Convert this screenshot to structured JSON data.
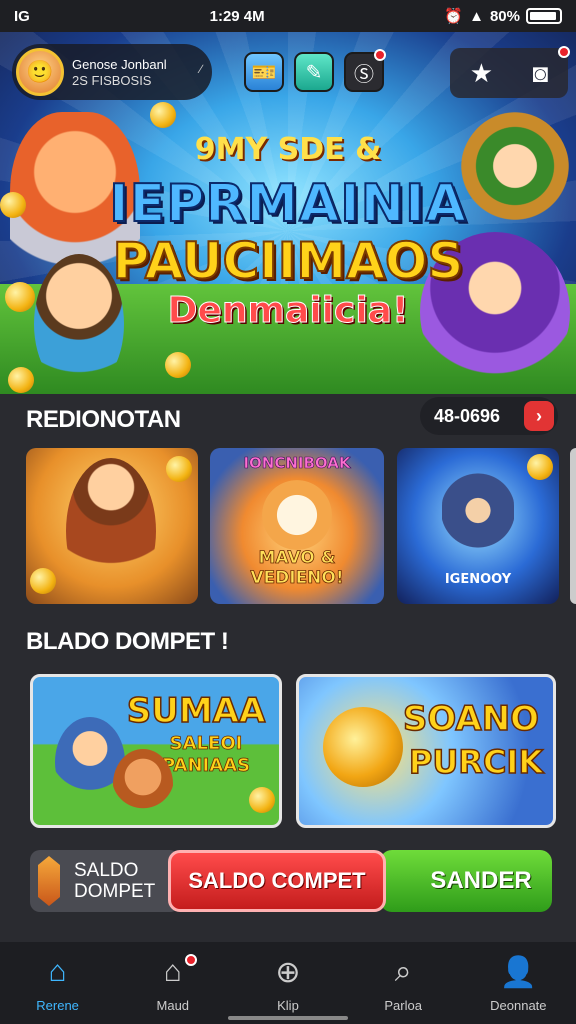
{
  "status_bar": {
    "carrier": "IG",
    "time": "1:29 4M",
    "battery": "80%"
  },
  "profile": {
    "name": "Genose Jonbanl",
    "id": "2S FISBOSIS"
  },
  "hero": {
    "line1": "9MY SDE &",
    "line2": "IEPRMAINIA",
    "line3": "PAUCIIMAOS",
    "line4": "Denmaiicia!"
  },
  "section1": {
    "title": "REDIONOTAN",
    "counter": "48-0696"
  },
  "cards_row1": [
    {
      "label": ""
    },
    {
      "label": "IONCNIBOAK",
      "sub": "MAVO & VEDIENO!"
    },
    {
      "label": "IGENOOY"
    }
  ],
  "section2": {
    "title": "BLADO DOMPET !"
  },
  "cards_row2": [
    {
      "label": "SUMAA",
      "sub": "SALEOI PANIAAS"
    },
    {
      "label": "SOANO",
      "sub": "PURCIK"
    }
  ],
  "bottom_actions": {
    "saldo_line1": "SALDO",
    "saldo_line2": "DOMPET",
    "red_button": "SALDO COMPET",
    "green_button": "SANDER"
  },
  "nav": [
    {
      "label": "Rerene",
      "icon": "home-icon"
    },
    {
      "label": "Maud",
      "icon": "house-alert-icon"
    },
    {
      "label": "Klip",
      "icon": "plus-circle-icon"
    },
    {
      "label": "Parloa",
      "icon": "search-icon"
    },
    {
      "label": "Deonnate",
      "icon": "user-icon"
    }
  ],
  "colors": {
    "accent_blue": "#3fb7ff",
    "red": "#e23434",
    "green": "#4cc12a",
    "gold": "#f3b312"
  }
}
